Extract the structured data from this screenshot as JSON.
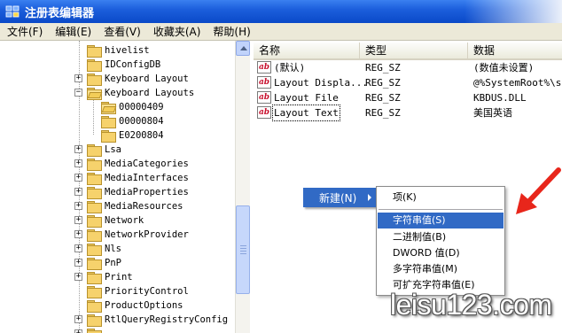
{
  "window": {
    "title": "注册表编辑器"
  },
  "menubar": [
    "文件(F)",
    "编辑(E)",
    "查看(V)",
    "收藏夹(A)",
    "帮助(H)"
  ],
  "tree": {
    "items": [
      {
        "label": "hivelist"
      },
      {
        "label": "IDConfigDB"
      },
      {
        "label": "Keyboard Layout"
      },
      {
        "label": "Keyboard Layouts"
      },
      {
        "label": "00000409"
      },
      {
        "label": "00000804"
      },
      {
        "label": "E0200804"
      },
      {
        "label": "Lsa"
      },
      {
        "label": "MediaCategories"
      },
      {
        "label": "MediaInterfaces"
      },
      {
        "label": "MediaProperties"
      },
      {
        "label": "MediaResources"
      },
      {
        "label": "Network"
      },
      {
        "label": "NetworkProvider"
      },
      {
        "label": "Nls"
      },
      {
        "label": "PnP"
      },
      {
        "label": "Print"
      },
      {
        "label": "PriorityControl"
      },
      {
        "label": "ProductOptions"
      },
      {
        "label": "RtlQueryRegistryConfig"
      }
    ]
  },
  "list": {
    "columns": [
      "名称",
      "类型",
      "数据"
    ],
    "rows": [
      {
        "name": "(默认)",
        "type": "REG_SZ",
        "data": "(数值未设置)"
      },
      {
        "name": "Layout Displa...",
        "type": "REG_SZ",
        "data": "@%SystemRoot%\\sys"
      },
      {
        "name": "Layout File",
        "type": "REG_SZ",
        "data": "KBDUS.DLL"
      },
      {
        "name": "Layout Text",
        "type": "REG_SZ",
        "data": "美国英语"
      }
    ]
  },
  "context_menu": {
    "new_label": "新建(N)",
    "submenu": [
      "项(K)",
      "字符串值(S)",
      "二进制值(B)",
      "DWORD 值(D)",
      "多字符串值(M)",
      "可扩充字符串值(E)"
    ]
  },
  "watermark": "leisu123.com",
  "colors": {
    "titlebar": "#0a49c8",
    "highlight": "#316ac5",
    "arrow": "#e8261b"
  }
}
